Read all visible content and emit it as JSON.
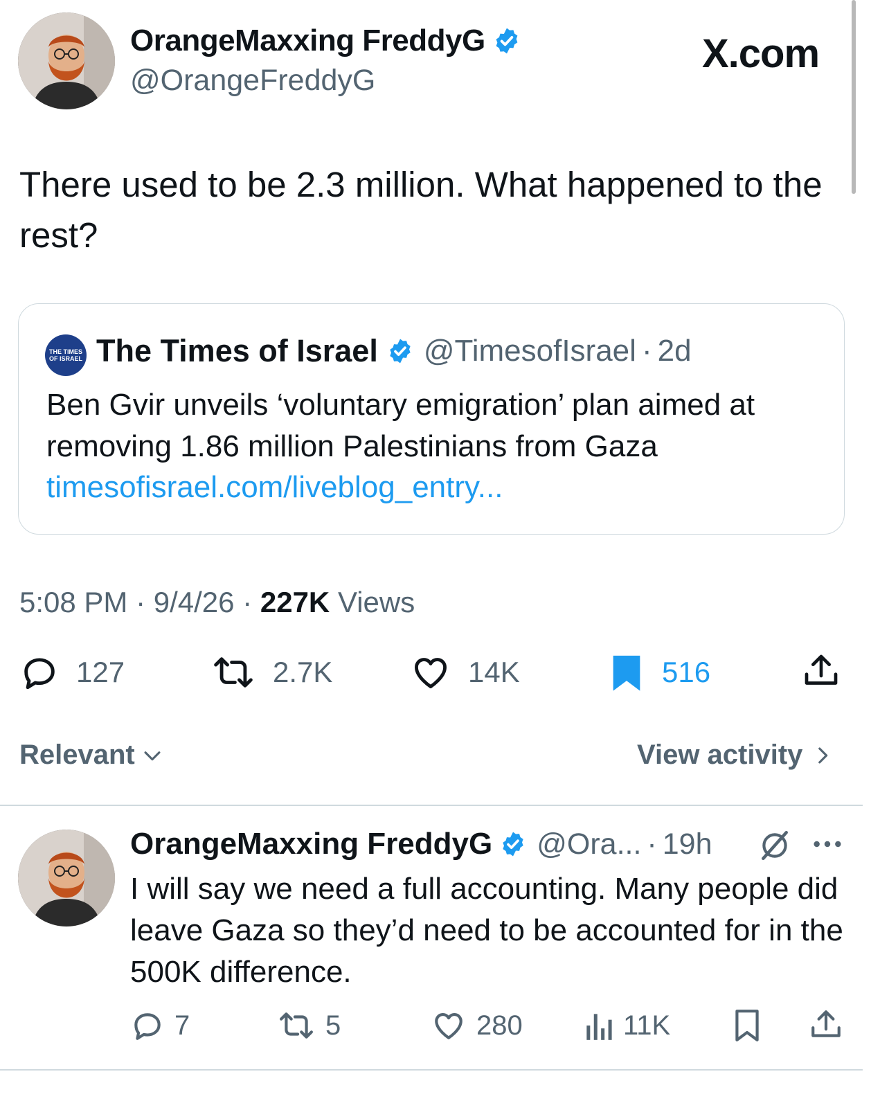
{
  "brand": "X.com",
  "accent_color": "#1d9bf0",
  "post": {
    "author_name": "OrangeMaxxing FreddyG",
    "author_handle": "@OrangeFreddyG",
    "text": "There used to be 2.3 million. What happened to the rest?",
    "quote": {
      "logo_text": "THE TIMES OF ISRAEL",
      "author_name": "The Times of Israel",
      "author_handle": "@TimesofIsrael",
      "separator": "·",
      "age": "2d",
      "text": "Ben Gvir unveils ‘voluntary emigration’ plan aimed at removing 1.86 million Palestinians from Gaza",
      "link": "timesofisrael.com/liveblog_entry..."
    },
    "time": "5:08 PM",
    "date": "9/4/26",
    "views_count": "227K",
    "views_label": "Views",
    "stats": {
      "replies": "127",
      "reposts": "2.7K",
      "likes": "14K",
      "bookmarks": "516"
    }
  },
  "filter": {
    "sort_label": "Relevant",
    "activity_label": "View activity"
  },
  "reply": {
    "author_name": "OrangeMaxxing FreddyG",
    "author_handle": "@Ora...",
    "separator": "·",
    "age": "19h",
    "text": "I will say we need a full accounting. Many people did leave Gaza so they’d need to be accounted for in the 500K difference.",
    "stats": {
      "replies": "7",
      "reposts": "5",
      "likes": "280",
      "views": "11K"
    }
  }
}
